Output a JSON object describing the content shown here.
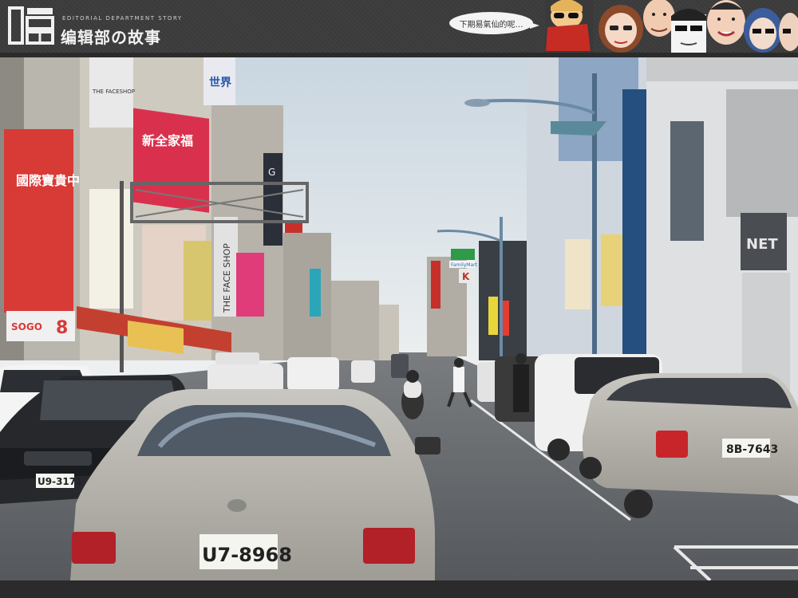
{
  "header": {
    "logo_glyph": "编",
    "brand_en": "EDITORIAL DEPARTMENT STORY",
    "brand_zh": "编辑部の故事",
    "speech_bubble": "下期易氣仙的呢…",
    "bg_color": "#3a3a3a"
  },
  "photo": {
    "signs": {
      "store_red": "國際寶貴中字",
      "store_red_top": "新全家福",
      "sign_world": "世界",
      "sign_faceshop": "THE FACE SHOP",
      "sign_face_small": "THE FACESHOP",
      "sign_g": "G",
      "sign_net": "NET",
      "sign_family": "FamilyMart",
      "sign_k": "K",
      "sign_sogo": "SOGO",
      "sign_8": "8"
    },
    "plates": {
      "center_car": "U7-8968",
      "bmw": "U9-3171",
      "right_car": "8B-7643"
    }
  }
}
